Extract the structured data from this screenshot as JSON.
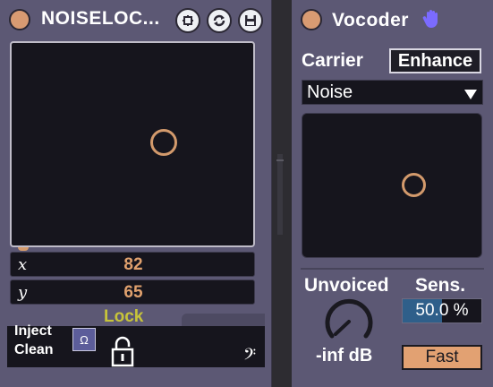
{
  "left_device": {
    "title": "NOISELOC...",
    "x_label": "x",
    "x_value": "82",
    "y_label": "y",
    "y_value": "65",
    "lock_label": "Lock",
    "inject_label_1": "Inject",
    "inject_label_2": "Clean",
    "omega_glyph": "Ω",
    "bass_clef_glyph": "𝄢",
    "icons": [
      "power-icon",
      "freeze-icon",
      "refresh-icon",
      "save-icon",
      "padlock-icon",
      "bass-clef-icon"
    ]
  },
  "right_device": {
    "title": "Vocoder",
    "carrier_label": "Carrier",
    "enhance_label": "Enhance",
    "carrier_value": "Noise",
    "unvoiced_label": "Unvoiced",
    "unvoiced_value": "-inf dB",
    "sens_label": "Sens.",
    "sens_number": "50.0",
    "sens_unit": "%",
    "sens_fraction": 0.5,
    "fast_label": "Fast",
    "icons": [
      "power-icon",
      "hand-icon",
      "dropdown-arrow-icon"
    ]
  },
  "colors": {
    "device_bg": "#5c5874",
    "panel_dark": "#16151d",
    "accent_orange": "#d39a6c",
    "lock_yellow": "#c7c43a",
    "sens_blue": "#2f5f8a",
    "hand_blue": "#7b6bff"
  }
}
